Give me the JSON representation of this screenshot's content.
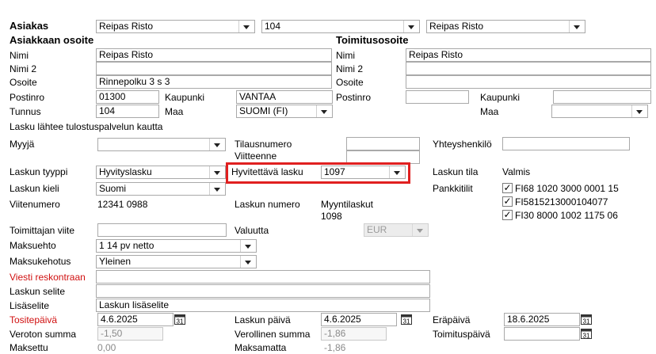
{
  "customer": {
    "label": "Asiakas",
    "name_select": "Reipas Risto",
    "number_select": "104",
    "name_select2": "Reipas Risto"
  },
  "customer_address": {
    "heading": "Asiakkaan osoite",
    "name_label": "Nimi",
    "name": "Reipas Risto",
    "name2_label": "Nimi 2",
    "name2": "",
    "address_label": "Osoite",
    "address": "Rinnepolku 3 s 3",
    "postal_label": "Postinro",
    "postal": "01300",
    "city_label": "Kaupunki",
    "city": "VANTAA",
    "id_label": "Tunnus",
    "id": "104",
    "country_label": "Maa",
    "country": "SUOMI (FI)"
  },
  "delivery_address": {
    "heading": "Toimitusosoite",
    "name_label": "Nimi",
    "name": "Reipas Risto",
    "name2_label": "Nimi 2",
    "name2": "",
    "address_label": "Osoite",
    "address": "",
    "postal_label": "Postinro",
    "postal": "",
    "city_label": "Kaupunki",
    "city": "",
    "country_label": "Maa",
    "country": ""
  },
  "print_note": "Lasku lähtee tulostuspalvelun kautta",
  "invoice": {
    "seller_label": "Myyjä",
    "seller": "",
    "order_no_label": "Tilausnumero",
    "order_no": "",
    "reference_label": "Viitteenne",
    "reference": "",
    "contact_label": "Yhteyshenkilö",
    "contact": "",
    "type_label": "Laskun tyyppi",
    "type": "Hyvityslasku",
    "credited_label": "Hyvitettävä lasku",
    "credited": "1097",
    "status_label": "Laskun tila",
    "status": "Valmis",
    "language_label": "Laskun kieli",
    "language": "Suomi",
    "bank_label": "Pankkitilit",
    "bank_accounts": [
      {
        "checked": "✓",
        "iban": "FI68 1020 3000 0001 15"
      },
      {
        "checked": "✓",
        "iban": "FI5815213000104077"
      },
      {
        "checked": "✓",
        "iban": "FI30 8000 1002 1175 06"
      }
    ],
    "ref_no_label": "Viitenumero",
    "ref_no": "12341 0988",
    "invoice_no_label": "Laskun numero",
    "invoice_no_type": "Myyntilaskut",
    "invoice_no": "1098",
    "supplier_ref_label": "Toimittajan viite",
    "supplier_ref": "",
    "currency_label": "Valuutta",
    "currency": "EUR",
    "payment_term_label": "Maksuehto",
    "payment_term": "1 14 pv netto",
    "dunning_label": "Maksukehotus",
    "dunning": "Yleinen",
    "ledger_msg_label": "Viesti reskontraan",
    "ledger_msg": "",
    "explanation_label": "Laskun selite",
    "explanation": "",
    "extra_label": "Lisäselite",
    "extra": "Laskun lisäselite",
    "voucher_date_label": "Tositepäivä",
    "voucher_date": "4.6.2025",
    "invoice_date_label": "Laskun päivä",
    "invoice_date": "4.6.2025",
    "due_date_label": "Eräpäivä",
    "due_date": "18.6.2025",
    "net_label": "Veroton summa",
    "net": "-1,50",
    "gross_label": "Verollinen summa",
    "gross": "-1,86",
    "delivery_date_label": "Toimituspäivä",
    "delivery_date": "",
    "paid_label": "Maksettu",
    "paid": "0,00",
    "to_pay_label": "Maksamatta",
    "to_pay": "-1,86"
  },
  "colors": {
    "required_label": "#d01010",
    "highlight": "#e02020"
  }
}
